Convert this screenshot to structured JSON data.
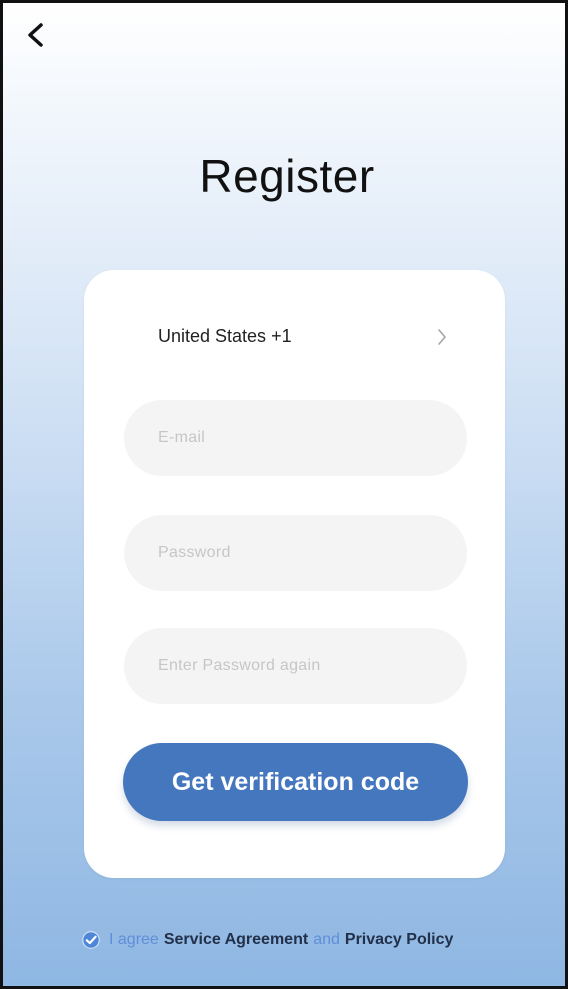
{
  "screen": {
    "title": "Register",
    "back_icon": "chevron-left-icon",
    "colors": {
      "background_top": "#ffffff",
      "background_bottom": "#8fb7e3",
      "card": "#ffffff",
      "field": "#f4f4f4",
      "primary_button": "#4577be",
      "agreement_link": "#223049",
      "agreement_text": "#5e8fd8"
    }
  },
  "form": {
    "country": {
      "label": "United States +1",
      "icon": "chevron-right-icon"
    },
    "email": {
      "value": "",
      "placeholder": "E-mail"
    },
    "password": {
      "value": "",
      "placeholder": "Password"
    },
    "password_confirm": {
      "value": "",
      "placeholder": "Enter Password again"
    },
    "submit_label": "Get verification code"
  },
  "agreement": {
    "checked": true,
    "icon": "check-circle-icon",
    "agree_text": "I agree",
    "service_link": "Service Agreement",
    "and_text": "and",
    "privacy_link": "Privacy Policy"
  }
}
